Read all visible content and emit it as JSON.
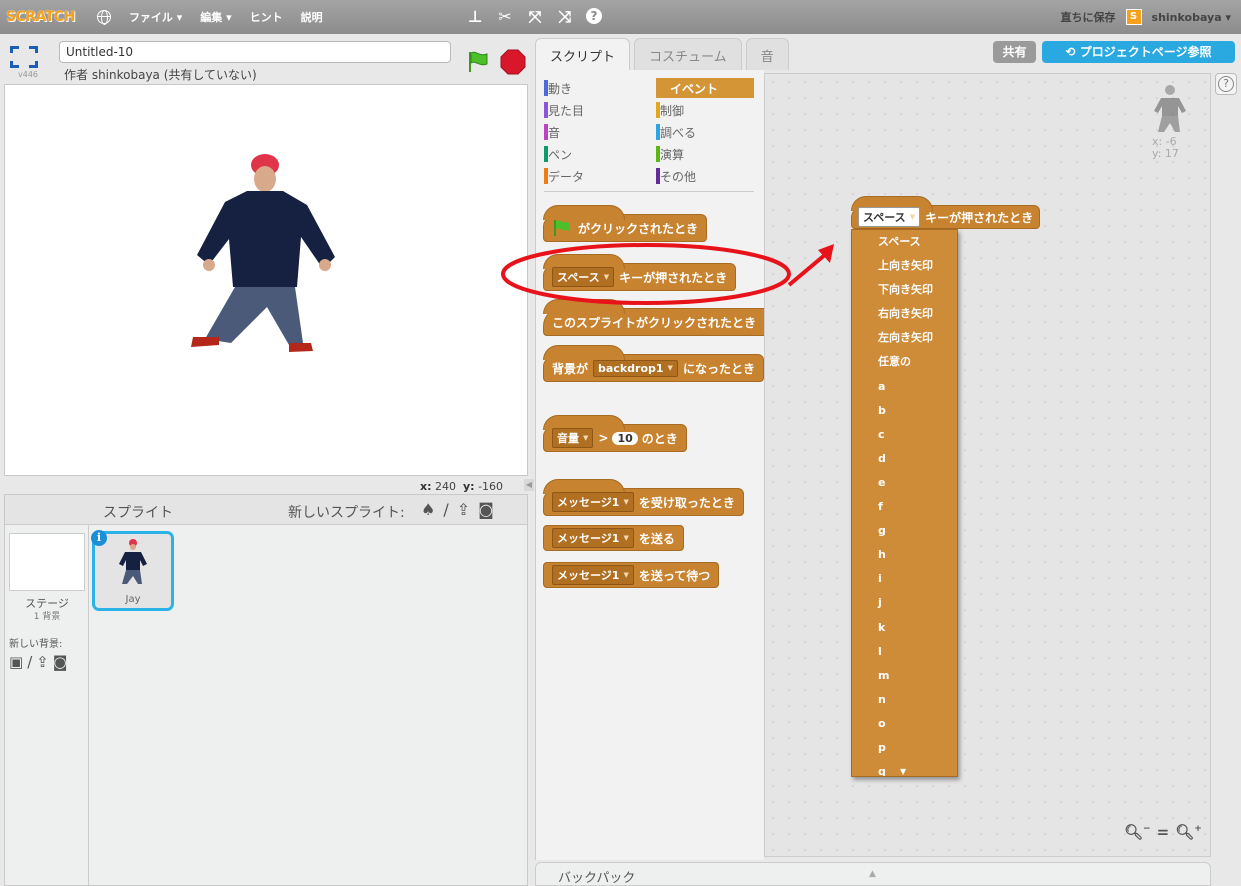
{
  "menubar": {
    "logo": "SCRATCH",
    "items": [
      "ファイル ▾",
      "編集 ▾",
      "ヒント",
      "説明"
    ],
    "save_now": "直ちに保存",
    "user_badge": "S",
    "username": "shinkobaya ▾",
    "help_glyph": "?"
  },
  "stage": {
    "version": "v446",
    "title": "Untitled-10",
    "author": "作者 shinkobaya (共有していない)",
    "x_label": "x:",
    "x_value": "240",
    "y_label": "y:",
    "y_value": "-160"
  },
  "library": {
    "title": "スプライト",
    "new_sprite_label": "新しいスプライト:",
    "stage_label": "ステージ",
    "stage_sub": "1 背景",
    "new_backdrop_label": "新しい背景:",
    "sprite_name": "Jay",
    "info_glyph": "i"
  },
  "tabs": [
    "スクリプト",
    "コスチューム",
    "音"
  ],
  "header_buttons": {
    "share": "共有",
    "project_page": "プロジェクトページ参照"
  },
  "categories": [
    {
      "label": "動き",
      "color": "#4a6cd4"
    },
    {
      "label": "見た目",
      "color": "#8a55d7"
    },
    {
      "label": "音",
      "color": "#bb42c3"
    },
    {
      "label": "ペン",
      "color": "#0e9a6c"
    },
    {
      "label": "データ",
      "color": "#ee7d16"
    },
    {
      "label": "イベント",
      "color": "#c88330"
    },
    {
      "label": "制御",
      "color": "#e1a91a"
    },
    {
      "label": "調べる",
      "color": "#2ca5e2"
    },
    {
      "label": "演算",
      "color": "#5cb712"
    },
    {
      "label": "その他",
      "color": "#632d99"
    }
  ],
  "blocks": {
    "flag_clicked": "がクリックされたとき",
    "key_dropdown": "スペース",
    "key_pressed": "キーが押されたとき",
    "sprite_clicked": "このスプライトがクリックされたとき",
    "backdrop_prefix": "背景が",
    "backdrop_dropdown": "backdrop1",
    "backdrop_suffix": "になったとき",
    "sensor_dropdown": "音量",
    "gt": ">",
    "sensor_value": "10",
    "sensor_suffix": "のとき",
    "message_dropdown": "メッセージ1",
    "receive": "を受け取ったとき",
    "broadcast": "を送る",
    "broadcast_wait": "を送って待つ"
  },
  "script": {
    "key_dropdown": "スペース",
    "key_pressed": "キーが押されたとき",
    "sprite_x": "x: -6",
    "sprite_y": "y: 17"
  },
  "dropdown_options": [
    "スペース",
    "上向き矢印",
    "下向き矢印",
    "右向き矢印",
    "左向き矢印",
    "任意の",
    "a",
    "b",
    "c",
    "d",
    "e",
    "f",
    "g",
    "h",
    "i",
    "j",
    "k",
    "l",
    "m",
    "n",
    "o",
    "p",
    "q"
  ],
  "backpack": {
    "label": "バックパック",
    "arrow": "▲"
  },
  "zoom": {
    "zoom_out": "−",
    "reset": "=",
    "zoom_in": "+"
  },
  "colors": {
    "event_block": "#c88330",
    "accent_blue": "#2aa8e0",
    "annotation_red": "#e8121a"
  }
}
